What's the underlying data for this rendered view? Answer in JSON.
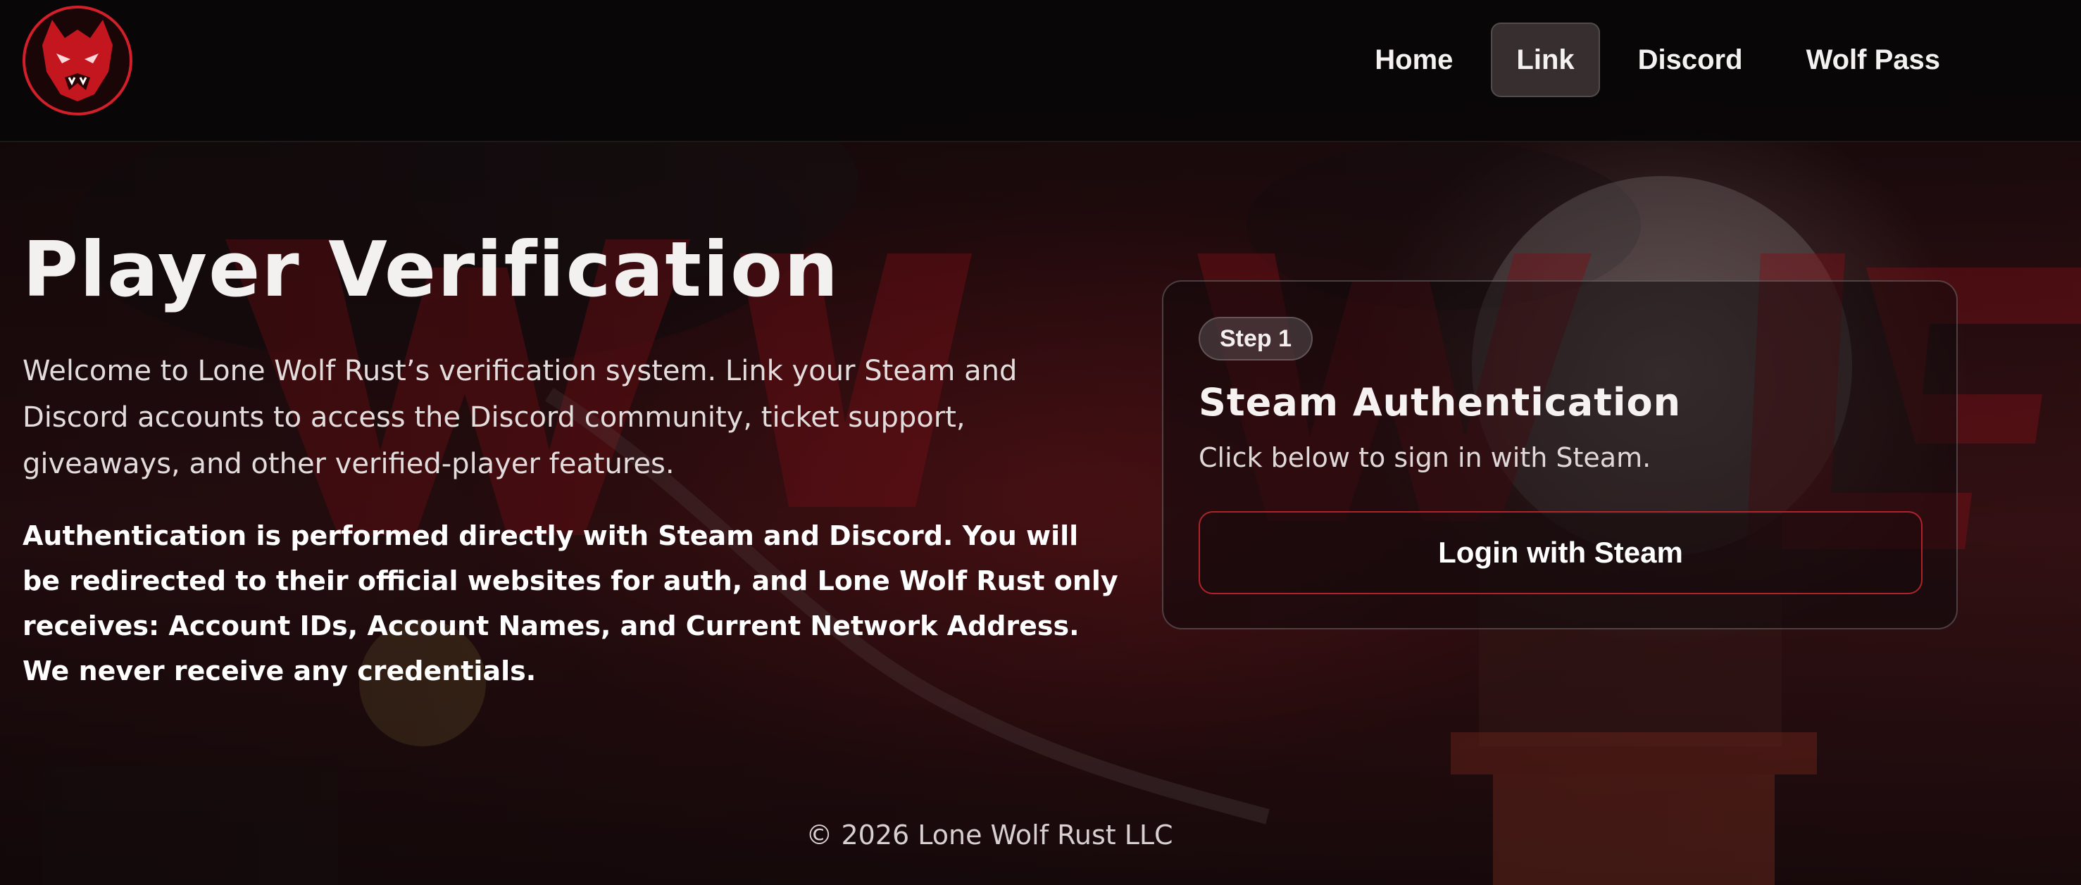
{
  "theme": {
    "accent": "#c8262e",
    "header_bg": "#080607",
    "card_border": "#3a3233"
  },
  "header": {
    "logo_icon": "wolf-head-logo-icon",
    "nav": [
      {
        "label": "Home",
        "active": false
      },
      {
        "label": "Link",
        "active": true
      },
      {
        "label": "Discord",
        "active": false
      },
      {
        "label": "Wolf Pass",
        "active": false
      }
    ]
  },
  "main": {
    "title": "Player Verification",
    "intro": "Welcome to Lone Wolf Rust’s verification system. Link your Steam and Discord accounts to access the Discord community, ticket support, giveaways, and other verified-player features.",
    "notice": "Authentication is performed directly with Steam and Discord. You will be redirected to their official websites for auth, and Lone Wolf Rust only receives: Account IDs, Account Names, and Current Network Address. We never receive any credentials."
  },
  "card": {
    "step_label": "Step 1",
    "title": "Steam Authentication",
    "description": "Click below to sign in with Steam.",
    "button_label": "Login with Steam"
  },
  "footer": {
    "copyright": "© 2026 Lone Wolf Rust LLC"
  }
}
